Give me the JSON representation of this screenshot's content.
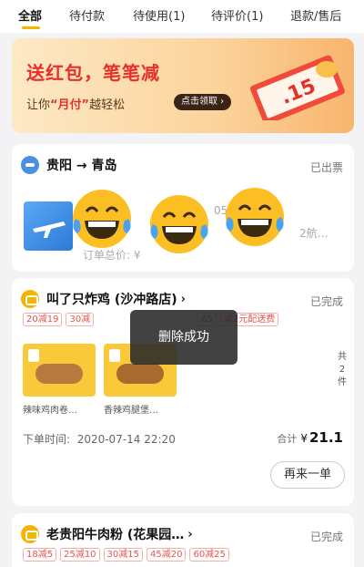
{
  "tabs": [
    {
      "label": "全部"
    },
    {
      "label": "待付款"
    },
    {
      "label": "待使用(1)"
    },
    {
      "label": "待评价(1)"
    },
    {
      "label": "退款/售后"
    }
  ],
  "banner": {
    "title": "送红包，笔笔减",
    "sub_prefix": "让你",
    "sub_highlight": "“月付”",
    "sub_suffix": "越轻松",
    "button": "点击领取 ›",
    "ticket_text": ".15"
  },
  "flight_order": {
    "route": "贵阳 → 青岛",
    "status": "已出票",
    "line1_tail": "05",
    "line2_tail": "2航…",
    "total_label": "订单总价: ¥"
  },
  "food_order": {
    "shop": "叫了只炸鸡 (沙冲路店)",
    "arrow": "›",
    "status": "已完成",
    "badges": [
      "20减19",
      "30减",
      "65",
      "减2元配送费"
    ],
    "items": [
      {
        "name": "辣味鸡肉卷…"
      },
      {
        "name": "香辣鸡腿堡…"
      }
    ],
    "count_text": [
      "共",
      "2",
      "件"
    ],
    "time_label": "下单时间:",
    "time_value": "2020-07-14 22:20",
    "total_label": "合计",
    "currency": "¥",
    "amount": "21.1",
    "reorder": "再来一单"
  },
  "noodle_order": {
    "shop": "老贵阳牛肉粉 (花果园…",
    "arrow": "›",
    "status": "已完成",
    "badges": [
      "18减5",
      "25减10",
      "30减15",
      "45减20",
      "60减25"
    ]
  },
  "toast": "删除成功",
  "overlay_icons": [
    "laughing-emoji-icon",
    "laughing-emoji-icon",
    "laughing-emoji-icon"
  ],
  "colors": {
    "accent": "#f5b400",
    "red": "#e5302a",
    "toast_bg": "#282828"
  }
}
